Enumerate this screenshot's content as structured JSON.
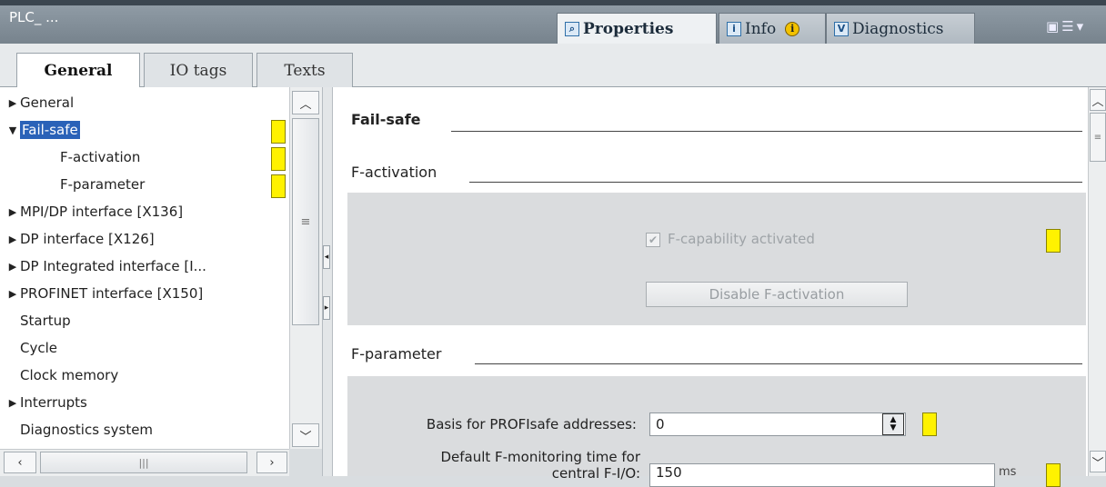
{
  "window": {
    "title": "PLC_ ..."
  },
  "top_tabs": [
    {
      "label": "Properties",
      "icon": "properties-icon"
    },
    {
      "label": "Info",
      "icon": "info-icon"
    },
    {
      "label": "Diagnostics",
      "icon": "diagnostics-icon"
    }
  ],
  "sub_tabs": [
    "General",
    "IO tags",
    "Texts"
  ],
  "tree": {
    "items": [
      {
        "label": "General",
        "expander": "collapsed",
        "level": 0
      },
      {
        "label": "Fail-safe",
        "expander": "expanded",
        "level": 0,
        "selected": true,
        "marker": true
      },
      {
        "label": "F-activation",
        "level": 2,
        "marker": true
      },
      {
        "label": "F-parameter",
        "level": 2,
        "marker": true
      },
      {
        "label": "MPI/DP interface [X136]",
        "expander": "collapsed",
        "level": 0
      },
      {
        "label": "DP interface [X126]",
        "expander": "collapsed",
        "level": 0
      },
      {
        "label": "DP Integrated interface [I...",
        "expander": "collapsed",
        "level": 0
      },
      {
        "label": "PROFINET interface [X150]",
        "expander": "collapsed",
        "level": 0
      },
      {
        "label": "Startup",
        "level": 1
      },
      {
        "label": "Cycle",
        "level": 1
      },
      {
        "label": "Clock memory",
        "level": 1
      },
      {
        "label": "Interrupts",
        "expander": "collapsed",
        "level": 0
      },
      {
        "label": "Diagnostics system",
        "level": 1
      }
    ]
  },
  "content": {
    "section_title": "Fail-safe",
    "f_activation": {
      "title": "F-activation",
      "checkbox_label": "F-capability activated",
      "checkbox_checked": true,
      "checkbox_enabled": false,
      "button_label": "Disable F-activation"
    },
    "f_parameter": {
      "title": "F-parameter",
      "basis_label": "Basis for PROFIsafe addresses:",
      "basis_value": "0",
      "monitor_label_line1": "Default F-monitoring time for",
      "monitor_label_line2": "central F-I/O:",
      "monitor_value": "150",
      "monitor_unit": "ms"
    }
  },
  "colors": {
    "marker": "#fff200",
    "selection": "#2a62b8"
  }
}
